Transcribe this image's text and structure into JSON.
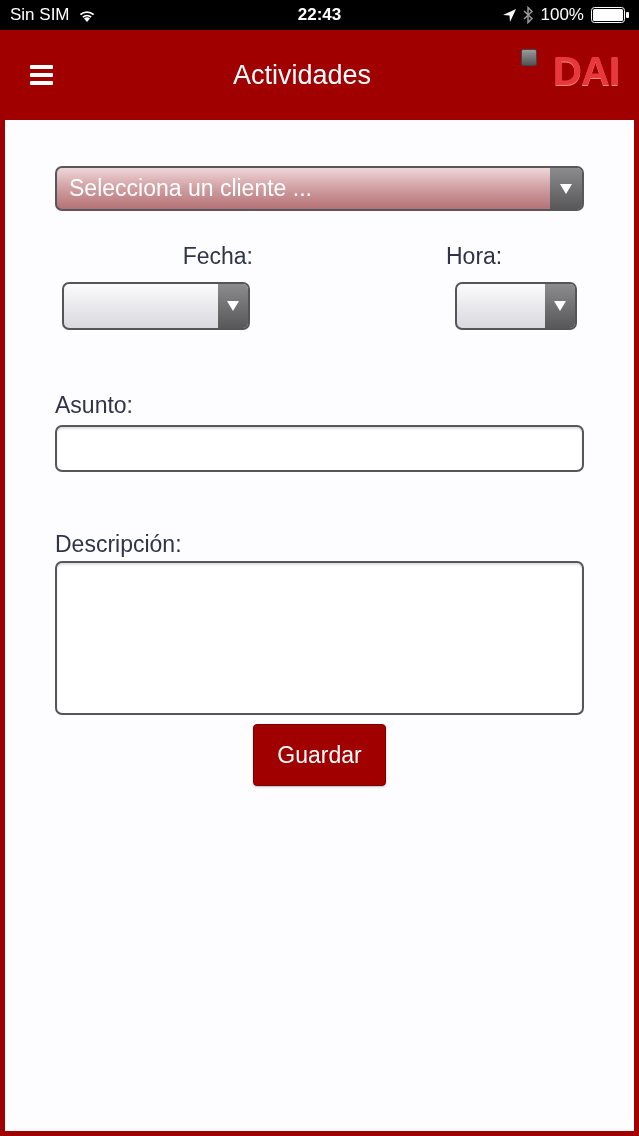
{
  "status_bar": {
    "carrier": "Sin SIM",
    "time": "22:43",
    "battery": "100%"
  },
  "header": {
    "title": "Actividades",
    "logo": "DAI"
  },
  "form": {
    "client_select": {
      "placeholder": "Selecciona un cliente ..."
    },
    "date": {
      "label": "Fecha:"
    },
    "time": {
      "label": "Hora:"
    },
    "subject": {
      "label": "Asunto:"
    },
    "description": {
      "label": "Descripción:"
    },
    "save_button": "Guardar"
  }
}
